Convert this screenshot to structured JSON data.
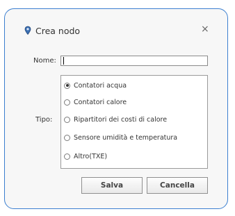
{
  "dialog": {
    "title": "Crea nodo",
    "close_glyph": "×",
    "icon": "app-pin-icon",
    "accent": "#3b7fd0"
  },
  "form": {
    "name_label": "Nome:",
    "name_value": "",
    "type_label": "Tipo:",
    "options": [
      {
        "label": "Contatori acqua",
        "selected": true
      },
      {
        "label": "Contatori calore",
        "selected": false
      },
      {
        "label": "Ripartitori dei costi di calore",
        "selected": false
      },
      {
        "label": "Sensore umidità e temperatura",
        "selected": false
      },
      {
        "label": "Altro(TXE)",
        "selected": false
      }
    ]
  },
  "buttons": {
    "save_label": "Salva",
    "cancel_label": "Cancella"
  }
}
